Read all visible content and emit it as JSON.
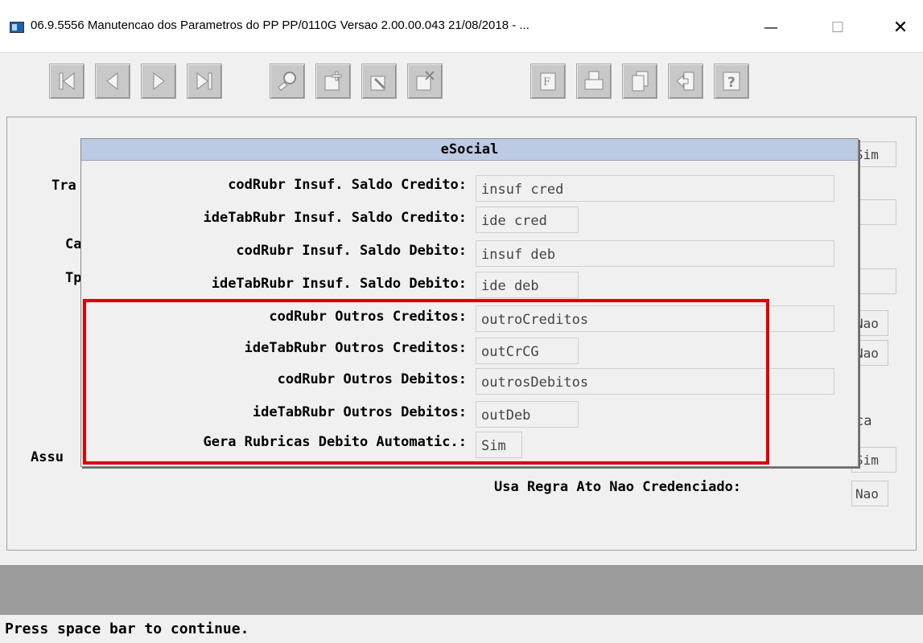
{
  "window": {
    "title": "06.9.5556 Manutencao dos  Parametros do PP PP/0110G Versao 2.00.00.043 21/08/2018 - ...",
    "min_symbol": "—",
    "max_symbol": "☐",
    "close_symbol": "✕"
  },
  "toolbar": {
    "buttons": [
      {
        "icon": "first-record-icon"
      },
      {
        "icon": "previous-record-icon"
      },
      {
        "icon": "next-record-icon"
      },
      {
        "icon": "last-record-icon"
      },
      {
        "icon": "search-icon"
      },
      {
        "icon": "add-icon"
      },
      {
        "icon": "edit-icon"
      },
      {
        "icon": "delete-icon"
      },
      {
        "icon": "filter-icon"
      },
      {
        "icon": "print-icon"
      },
      {
        "icon": "copy-icon"
      },
      {
        "icon": "exit-icon"
      },
      {
        "icon": "help-icon"
      }
    ]
  },
  "background": {
    "labels": [
      "Tra",
      "Ca",
      "Tp",
      "Assu",
      "Usa Regra Ato Nao Credenciado:"
    ],
    "right_values": [
      "Sim",
      "Nao",
      "Nao",
      "ca",
      "Sim",
      "Nao"
    ]
  },
  "dialog": {
    "title": "eSocial",
    "rows": [
      {
        "label": "codRubr Insuf. Saldo Credito:",
        "value": "insuf cred"
      },
      {
        "label": "ideTabRubr Insuf. Saldo Credito:",
        "value": "ide cred"
      },
      {
        "label": "codRubr Insuf. Saldo Debito:",
        "value": "insuf deb"
      },
      {
        "label": "ideTabRubr Insuf. Saldo Debito:",
        "value": "ide deb"
      },
      {
        "label": "codRubr Outros Creditos:",
        "value": "outroCreditos"
      },
      {
        "label": "ideTabRubr Outros Creditos:",
        "value": "outCrCG"
      },
      {
        "label": "codRubr Outros Debitos:",
        "value": "outrosDebitos"
      },
      {
        "label": "ideTabRubr Outros Debitos:",
        "value": "outDeb"
      },
      {
        "label": "Gera Rubricas Debito Automatic.:",
        "value": "Sim"
      }
    ]
  },
  "status": {
    "message": "Press space bar to continue."
  },
  "colors": {
    "highlight": "#e30000",
    "dialog_header": "#bccbe3",
    "status_strip": "#9c9c9c"
  }
}
